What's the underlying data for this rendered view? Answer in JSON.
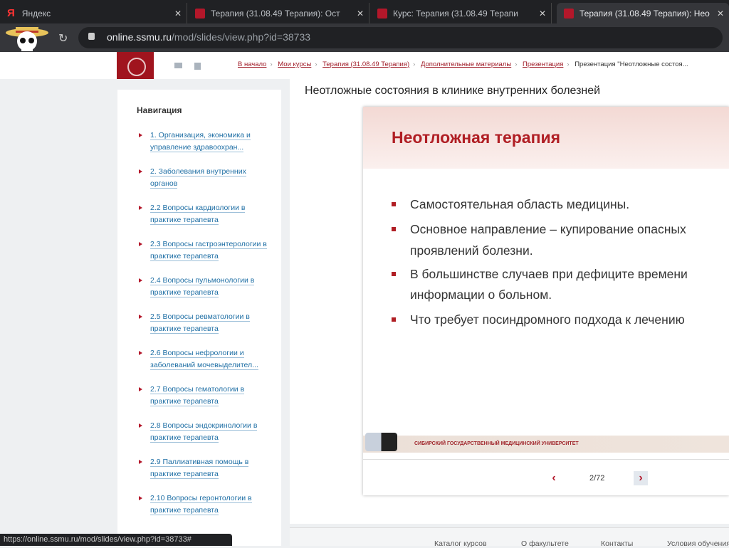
{
  "tabs": [
    {
      "title": "Яндекс"
    },
    {
      "title": "Терапия (31.08.49 Терапия): Ост"
    },
    {
      "title": "Курс: Терапия (31.08.49 Терапи"
    },
    {
      "title": "Терапия (31.08.49 Терапия): Нео"
    }
  ],
  "address": {
    "domain": "online.ssmu.ru",
    "path": "/mod/slides/view.php?id=38733"
  },
  "breadcrumbs": [
    "В начало",
    "Мои курсы",
    "Терапия (31.08.49 Терапия)",
    "Дополнительные материалы",
    "Презентация"
  ],
  "breadcrumb_current": "Презентация \"Неотложные состоя...",
  "sidebar": {
    "title": "Навигация",
    "items": [
      "1. Организация, экономика и управление здравоохран...",
      "2. Заболевания внутренних органов",
      "2.2 Вопросы кардиологии в практике терапевта",
      "2.3 Вопросы гастроэнтерологии в практике терапевта",
      "2.4 Вопросы пульмонологии в практике терапевта",
      "2.5 Вопросы ревматологии в практике терапевта",
      "2.6 Вопросы нефрологии и заболеваний мочевыделител...",
      "2.7 Вопросы гематологии в практике терапевта",
      "2.8 Вопросы эндокринологии в практике терапевта",
      "2.9 Паллиативная помощь в практике терапевта",
      "2.10 Вопросы геронтологии в практике терапевта"
    ]
  },
  "page_title": "Неотложные состояния в клинике внутренних болезней",
  "slide": {
    "title": "Неотложная терапия",
    "bullets": [
      "Самостоятельная область медицины.",
      "Основное направление – купирование опасных",
      "проявлений болезни.",
      "В большинстве случаев при дефиците времени",
      "информации о больном.",
      "Что требует посиндромного подхода к лечению"
    ],
    "footer": "СИБИРСКИЙ ГОСУДАРСТВЕННЫЙ МЕДИЦИНСКИЙ УНИВЕРСИТЕТ"
  },
  "pager": {
    "prev": "‹",
    "next": "›",
    "count": "2/72"
  },
  "footer_links": [
    "Каталог курсов",
    "О факультете",
    "Контакты",
    "Условия обучения"
  ],
  "status_url": "https://online.ssmu.ru/mod/slides/view.php?id=38733#"
}
